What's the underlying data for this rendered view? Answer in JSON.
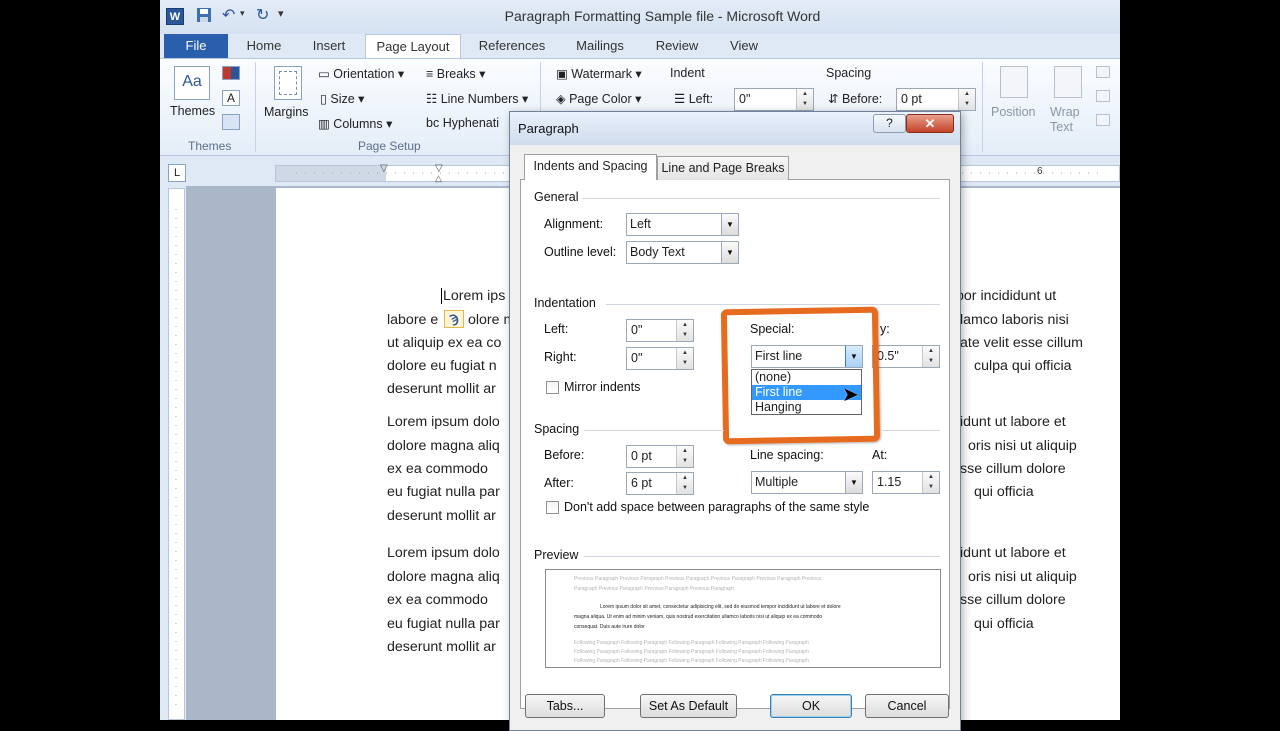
{
  "window": {
    "title": "Paragraph Formatting Sample file  -  Microsoft Word",
    "app_icon": "W"
  },
  "tabs": {
    "file": "File",
    "home": "Home",
    "insert": "Insert",
    "page_layout": "Page Layout",
    "references": "References",
    "mailings": "Mailings",
    "review": "Review",
    "view": "View"
  },
  "ribbon": {
    "themes": "Themes",
    "themes_group": "Themes",
    "margins": "Margins",
    "orientation": "Orientation",
    "size": "Size",
    "columns": "Columns",
    "breaks": "Breaks",
    "line_numbers": "Line Numbers",
    "hyphenation": "Hyphenati",
    "page_setup_group": "Page Setup",
    "watermark": "Watermark",
    "page_color": "Page Color",
    "indent_head": "Indent",
    "indent_left_label": "Left:",
    "indent_left_value": "0\"",
    "spacing_head": "Spacing",
    "spacing_before_label": "Before:",
    "spacing_before_value": "0 pt",
    "position": "Position",
    "wrap_text_1": "Wrap",
    "wrap_text_2": "Text"
  },
  "document": {
    "lines": [
      "Lorem ips",
      "por incididunt ut",
      "labore e",
      "olore m",
      "lamco laboris nisi",
      "ut aliquip ex ea co",
      "ate velit esse cillum",
      "dolore eu fugiat n",
      "culpa qui officia",
      "deserunt mollit ar",
      "Lorem ipsum dolo",
      "idunt ut labore et",
      "dolore magna aliq",
      "oris nisi ut aliquip",
      "ex ea commodo",
      "sse cillum dolore",
      "eu fugiat nulla par",
      "qui officia",
      "deserunt mollit ar",
      "Lorem ipsum dolo",
      "idunt ut labore et",
      "dolore magna aliq",
      "oris nisi ut aliquip",
      "ex ea commodo",
      "sse cillum dolore",
      "eu fugiat nulla par",
      "qui officia",
      "deserunt mollit ar"
    ]
  },
  "dialog": {
    "title": "Paragraph",
    "help": "?",
    "tab_indents": "Indents and Spacing",
    "tab_breaks": "Line and Page Breaks",
    "general": "General",
    "alignment_label": "Alignment:",
    "alignment_value": "Left",
    "outline_label": "Outline level:",
    "outline_value": "Body Text",
    "indentation": "Indentation",
    "left_label": "Left:",
    "left_value": "0\"",
    "right_label": "Right:",
    "right_value": "0\"",
    "special_label": "Special:",
    "special_value": "First line",
    "by_label": "y:",
    "by_value": "0.5\"",
    "special_options": [
      "(none)",
      "First line",
      "Hanging"
    ],
    "special_selected_index": 1,
    "mirror_label": "Mirror indents",
    "spacing": "Spacing",
    "before_label": "Before:",
    "before_value": "0 pt",
    "after_label": "After:",
    "after_value": "6 pt",
    "line_spacing_label": "Line spacing:",
    "line_spacing_value": "Multiple",
    "at_label": "At:",
    "at_value": "1.15",
    "dont_add_label": "Don't add space between paragraphs of the same style",
    "preview": "Preview",
    "preview_text": [
      "Previous Paragraph Previous Paragraph Previous Paragraph Previous Paragraph Previous Paragraph Previous",
      "Paragraph Previous Paragraph Previous Paragraph Previous Paragraph",
      "Lorem ipsum dolor sit amet, consectetur adipisicing elit, sed do eiusmod tempor incididunt ut labore et dolore",
      "magna aliqua. Ut enim ad minim veniam, quis nostrud exercitation ullamco laboris nisi ut aliquip ex ea commodo",
      "consequat. Duis aute irure dolor",
      "Following Paragraph Following Paragraph Following Paragraph Following Paragraph Following Paragraph",
      "Following Paragraph Following Paragraph Following Paragraph Following Paragraph Following Paragraph",
      "Following Paragraph Following Paragraph Following Paragraph Following Paragraph Following Paragraph"
    ],
    "tabs_btn": "Tabs...",
    "default_btn": "Set As Default",
    "ok_btn": "OK",
    "cancel_btn": "Cancel"
  },
  "colors": {
    "highlight": "#e66b1f",
    "file_tab": "#2a5fad",
    "selection": "#3399ff"
  }
}
